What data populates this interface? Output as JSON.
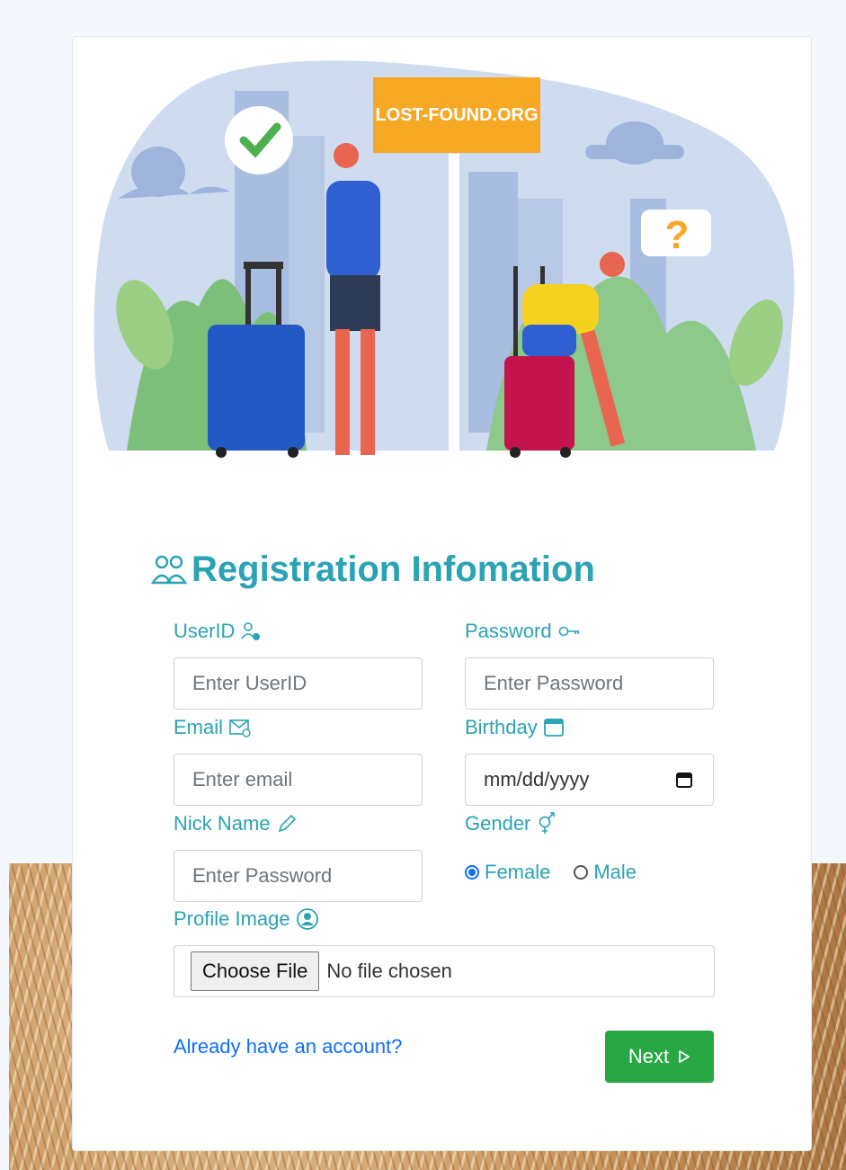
{
  "hero": {
    "sign_text": "LOST-FOUND.ORG",
    "question_mark": "?"
  },
  "form": {
    "title": "Registration Infomation",
    "fields": {
      "userid": {
        "label": "UserID",
        "placeholder": "Enter UserID"
      },
      "password": {
        "label": "Password",
        "placeholder": "Enter Password"
      },
      "email": {
        "label": "Email",
        "placeholder": "Enter email"
      },
      "birthday": {
        "label": "Birthday",
        "value": "mm/dd/yyyy"
      },
      "nickname": {
        "label": "Nick Name",
        "placeholder": "Enter Password"
      },
      "gender": {
        "label": "Gender",
        "options": [
          {
            "label": "Female",
            "selected": true
          },
          {
            "label": "Male",
            "selected": false
          }
        ]
      },
      "profile_image": {
        "label": "Profile Image",
        "button": "Choose File",
        "status": "No file chosen"
      }
    },
    "login_link": "Already have an account?",
    "next_button": "Next"
  },
  "colors": {
    "accent": "#2aa3b4",
    "link": "#0d6efd",
    "next": "#28a745"
  }
}
